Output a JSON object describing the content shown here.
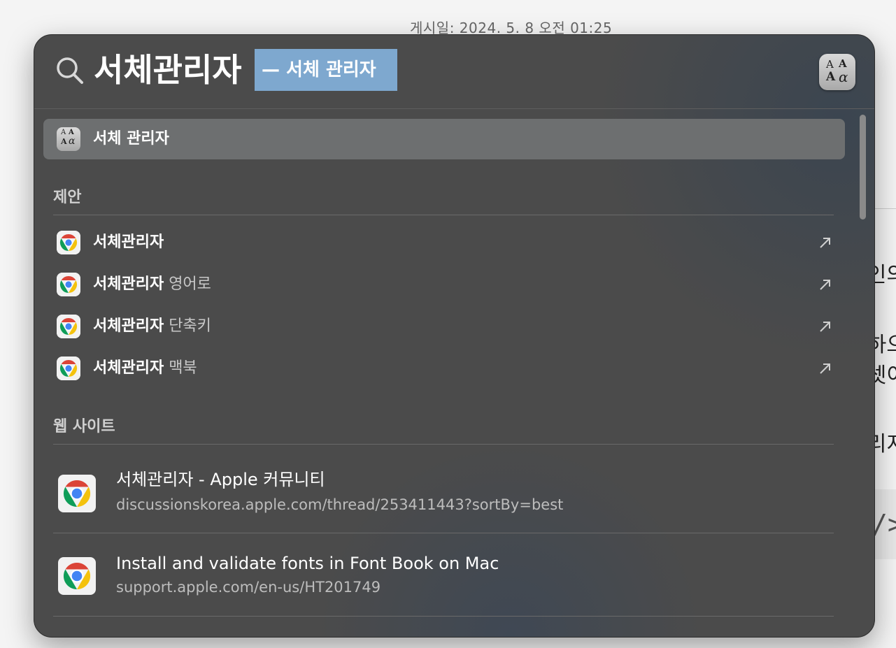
{
  "background_page": {
    "post_date": "게시일: 2024. 5. 8 오전 01:25",
    "snippets": [
      "인의",
      "하으",
      "셋이",
      "리지"
    ],
    "code_glyph": "/>"
  },
  "spotlight": {
    "query": "서체관리자",
    "completion_hint": "— 서체 관리자",
    "top_hit": {
      "label": "서체 관리자",
      "icon": "font-book-icon"
    },
    "suggestions_heading": "제안",
    "suggestions": [
      {
        "prefix": "서체관리자",
        "suffix": ""
      },
      {
        "prefix": "서체관리자",
        "suffix": " 영어로"
      },
      {
        "prefix": "서체관리자",
        "suffix": " 단축키"
      },
      {
        "prefix": "서체관리자",
        "suffix": " 맥북"
      }
    ],
    "websites_heading": "웹 사이트",
    "websites": [
      {
        "title": "서체관리자 - Apple 커뮤니티",
        "url": "discussionskorea.apple.com/thread/253411443?sortBy=best"
      },
      {
        "title": "Install and validate fonts in Font Book on Mac",
        "url": "support.apple.com/en-us/HT201749"
      }
    ]
  },
  "colors": {
    "panel_bg": "#4b4b4b",
    "selection_bg": "#6d6f70",
    "completion_bg": "#7ea8cf"
  }
}
